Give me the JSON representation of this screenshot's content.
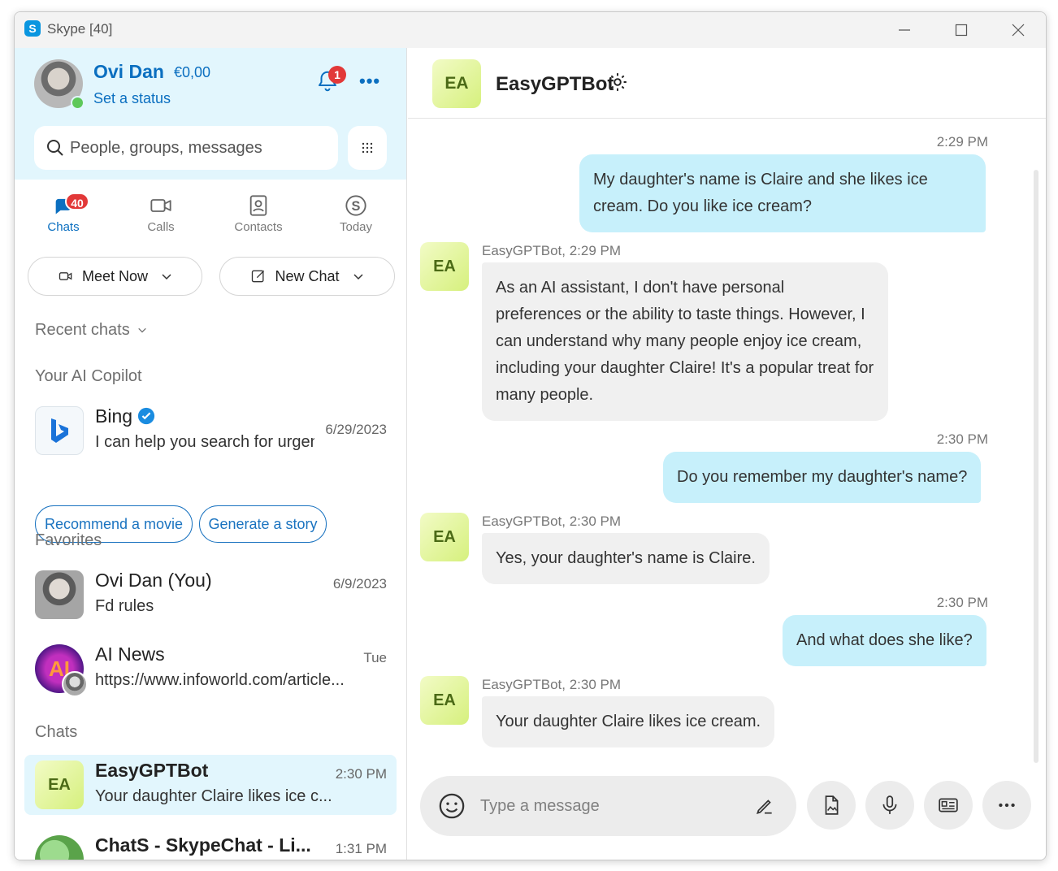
{
  "window": {
    "title": "Skype [40]",
    "logo": "S"
  },
  "profile": {
    "name": "Ovi Dan",
    "credit": "€0,00",
    "status_text": "Set a status",
    "notification_count": "1"
  },
  "search": {
    "placeholder": "People, groups, messages"
  },
  "nav": {
    "chats_label": "Chats",
    "chats_badge": "40",
    "calls_label": "Calls",
    "contacts_label": "Contacts",
    "today_label": "Today"
  },
  "actions": {
    "meet_now": "Meet Now",
    "new_chat": "New Chat"
  },
  "sections": {
    "recent": "Recent chats",
    "copilot": "Your AI Copilot",
    "favorites": "Favorites",
    "chats": "Chats"
  },
  "copilot": {
    "name": "Bing",
    "date": "6/29/2023",
    "preview": "I can help you search for urgent",
    "suggestions": [
      "Recommend a movie",
      "Generate a story"
    ]
  },
  "favorites": [
    {
      "name": "Ovi Dan (You)",
      "date": "6/9/2023",
      "preview": "Fd rules"
    },
    {
      "name": "AI News",
      "date": "Tue",
      "preview": "https://www.infoworld.com/article...",
      "avatar_text": "AI"
    }
  ],
  "chats": [
    {
      "name": "EasyGPTBot",
      "time": "2:30 PM",
      "preview": "Your daughter Claire likes ice c...",
      "avatar_text": "EA"
    },
    {
      "name": "ChatS - SkypeChat - Li...",
      "time": "1:31 PM"
    }
  ],
  "conversation": {
    "title": "EasyGPTBot",
    "avatar_text": "EA",
    "messages": [
      {
        "time": "2:29 PM",
        "text": "My daughter's name is Claire and she likes ice cream. Do you like ice cream?"
      },
      {
        "meta": "EasyGPTBot, 2:29 PM",
        "text": "As an AI assistant, I don't have personal preferences or the ability to taste things. However, I can understand why many people enjoy ice cream, including your daughter Claire! It's a popular treat for many people."
      },
      {
        "time": "2:30 PM",
        "text": "Do you remember my daughter's name?"
      },
      {
        "meta": "EasyGPTBot, 2:30 PM",
        "text": "Yes, your daughter's name is Claire."
      },
      {
        "time": "2:30 PM",
        "text": "And what does she like?"
      },
      {
        "meta": "EasyGPTBot, 2:30 PM",
        "text": "Your daughter Claire likes ice cream."
      }
    ]
  },
  "composer": {
    "placeholder": "Type a message"
  },
  "colors": {
    "accent": "#0b6fc0",
    "sidebar_bg": "#e2f6fd",
    "outgoing_bubble": "#c7f0fb",
    "incoming_bubble": "#f0f0f0",
    "badge": "#e23838"
  }
}
